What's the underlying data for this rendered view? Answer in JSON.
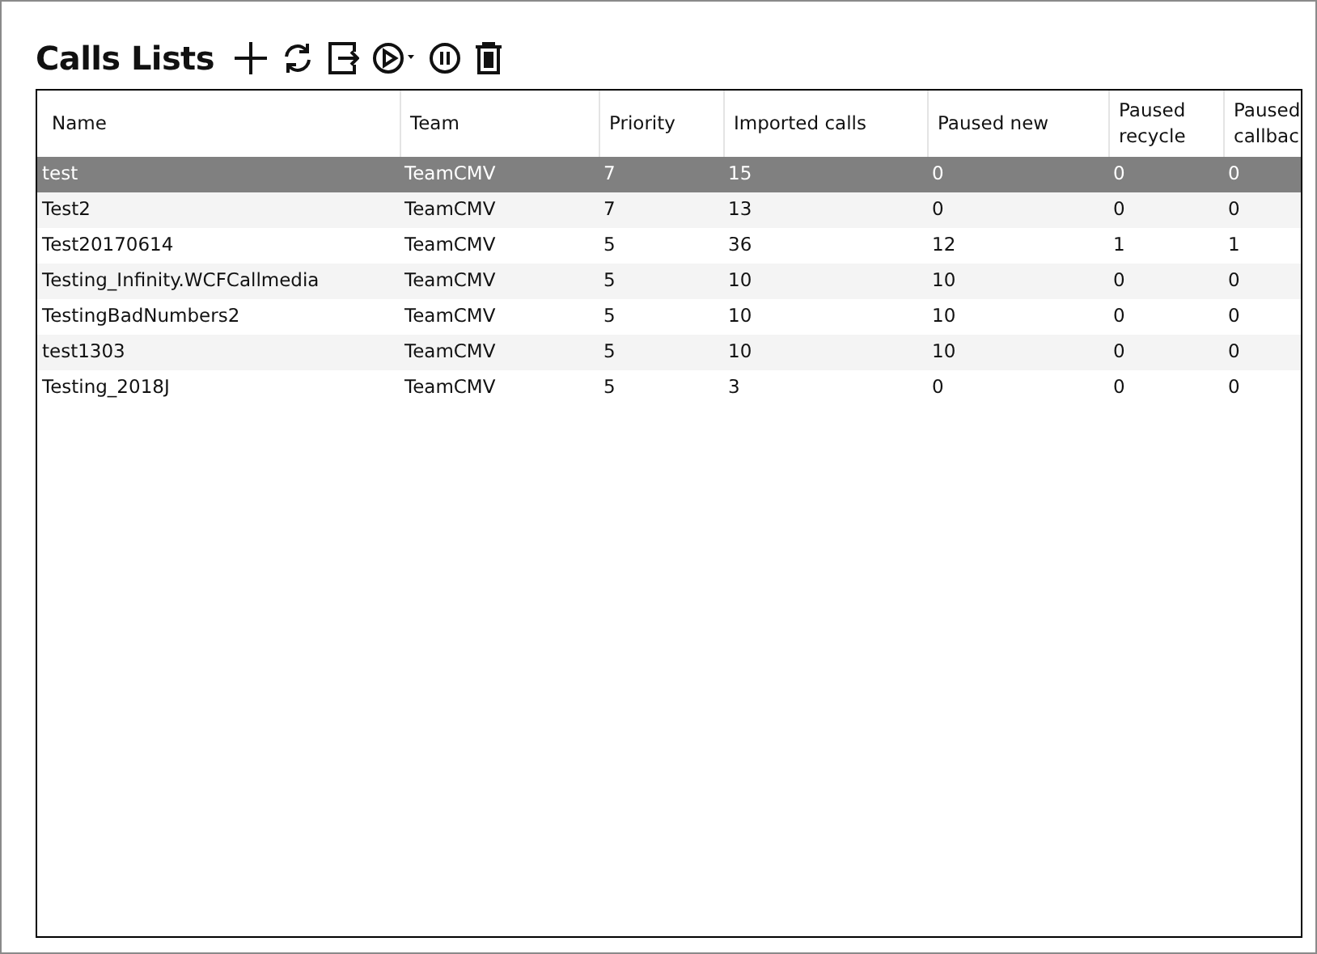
{
  "title": "Calls Lists",
  "toolbar": [
    {
      "kind": "add"
    },
    {
      "kind": "refresh"
    },
    {
      "kind": "export"
    },
    {
      "kind": "play"
    },
    {
      "kind": "pause"
    },
    {
      "kind": "delete"
    }
  ],
  "table": {
    "columns": [
      "Name",
      "Team",
      "Priority",
      "Imported calls",
      "Paused new",
      "Paused recycle",
      "Paused callbac"
    ],
    "rows": [
      {
        "selected": true,
        "cells": [
          "test",
          "TeamCMV",
          "7",
          "15",
          "0",
          "0",
          "0"
        ]
      },
      {
        "selected": false,
        "cells": [
          "Test2",
          "TeamCMV",
          "7",
          "13",
          "0",
          "0",
          "0"
        ]
      },
      {
        "selected": false,
        "cells": [
          "Test20170614",
          "TeamCMV",
          "5",
          "36",
          "12",
          "1",
          "1"
        ]
      },
      {
        "selected": false,
        "cells": [
          "Testing_Infinity.WCFCallmedia",
          "TeamCMV",
          "5",
          "10",
          "10",
          "0",
          "0"
        ]
      },
      {
        "selected": false,
        "cells": [
          "TestingBadNumbers2",
          "TeamCMV",
          "5",
          "10",
          "10",
          "0",
          "0"
        ]
      },
      {
        "selected": false,
        "cells": [
          "test1303",
          "TeamCMV",
          "5",
          "10",
          "10",
          "0",
          "0"
        ]
      },
      {
        "selected": false,
        "cells": [
          "Testing_2018J",
          "TeamCMV",
          "5",
          "3",
          "0",
          "0",
          "0"
        ]
      }
    ]
  }
}
